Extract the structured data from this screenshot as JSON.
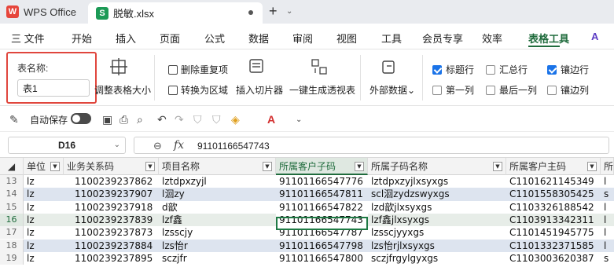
{
  "titlebar": {
    "app_name": "WPS Office",
    "app_icon": "W",
    "doc_icon": "S",
    "doc_name": "脱敏.xlsx",
    "new_tab": "+"
  },
  "menu": {
    "file": "三 文件",
    "items": [
      "开始",
      "插入",
      "页面",
      "公式",
      "数据",
      "审阅",
      "视图",
      "工具",
      "会员专享",
      "效率",
      "表格工具"
    ],
    "active": "表格工具"
  },
  "ribbon": {
    "table_name_label": "表名称:",
    "table_name_value": "表1",
    "resize_table": "调整表格大小",
    "remove_duplicates": "删除重复项",
    "convert_to_range": "转换为区域",
    "insert_slicer": "插入切片器",
    "pivot_table": "一键生成透视表",
    "external_data": "外部数据",
    "checkboxes": [
      {
        "label": "标题行",
        "checked": true
      },
      {
        "label": "汇总行",
        "checked": false
      },
      {
        "label": "镶边行",
        "checked": true
      },
      {
        "label": "第一列",
        "checked": false
      },
      {
        "label": "最后一列",
        "checked": false
      },
      {
        "label": "镶边列",
        "checked": false
      }
    ]
  },
  "quickbar": {
    "autosave_label": "自动保存"
  },
  "formula_bar": {
    "cell_ref": "D16",
    "fx": "fx",
    "value": "91101166547743"
  },
  "grid": {
    "headers": [
      "单位",
      "业务关系码",
      "项目名称",
      "所属客户子码",
      "所属子码名称",
      "所属客户主码",
      "所"
    ],
    "rows": [
      {
        "num": "13",
        "cells": [
          "lz",
          "1100239237862",
          "lztdpxzyjl",
          "91101166547776",
          "lztdpxzyjlxsyxgs",
          "C1101621145349",
          "l"
        ]
      },
      {
        "num": "14",
        "cells": [
          "lz",
          "1100239237907",
          "l洄zy",
          "91101166547811",
          "scl洄zydzswyxgs",
          "C1101558305425",
          "s"
        ]
      },
      {
        "num": "15",
        "cells": [
          "lz",
          "1100239237918",
          "d歆",
          "91101166547822",
          "lzd歆jlxsyxgs",
          "C1103326188542",
          "l"
        ]
      },
      {
        "num": "16",
        "cells": [
          "lz",
          "1100239237839",
          "lzf鑫",
          "91101166547743",
          "lzf鑫jlxsyxgs",
          "C1103913342311",
          "l"
        ]
      },
      {
        "num": "17",
        "cells": [
          "lz",
          "1100239237873",
          "lzsscjy",
          "91101166547787",
          "lzsscjyyxgs",
          "C1101451945775",
          "l"
        ]
      },
      {
        "num": "18",
        "cells": [
          "lz",
          "1100239237884",
          "lzs怡r",
          "91101166547798",
          "lzs怡rjlxsyxgs",
          "C1101332371585",
          "l"
        ]
      },
      {
        "num": "19",
        "cells": [
          "lz",
          "1100239237895",
          "sczjfr",
          "91101166547800",
          "sczjfrgylgyxgs",
          "C1103003620387",
          "s"
        ]
      }
    ]
  }
}
